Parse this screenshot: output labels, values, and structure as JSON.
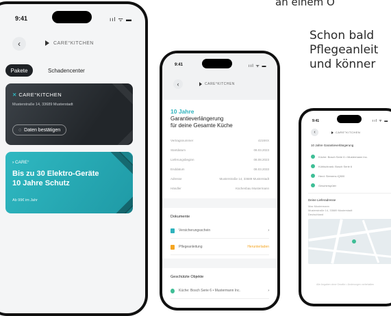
{
  "background_text": {
    "line0": "an einem O",
    "line1": "Schon bald",
    "line2": "Pflegeanleit",
    "line3": "und könner"
  },
  "status": {
    "time": "9:41",
    "icons": "ııl ᯤ ▬"
  },
  "brand": "CARE°KITCHEN",
  "back_icon": "‹",
  "phone1": {
    "tabs": [
      "Pakete",
      "Schadencenter"
    ],
    "card1": {
      "logo": "CARE°KITCHEN",
      "address": "Musterstraße 14, 33689 Musterstadt",
      "button": "Daten bestätigen"
    },
    "card2": {
      "logo": "CARE°",
      "headline1": "Bis zu 30 Elektro-Geräte",
      "headline2": "10 Jahre Schutz",
      "price": "Ab 99€ im Jahr"
    }
  },
  "phone2": {
    "title1": "10 Jahre",
    "title2": "Garantieverlängerung",
    "title3": "für deine Gesamte Küche",
    "rows": [
      [
        "Vertragsnummer",
        "4219XX"
      ],
      [
        "Startdatum",
        "08.03.2023"
      ],
      [
        "Lieferungsbeginn",
        "08.08.2023"
      ],
      [
        "Enddatum",
        "08.03.2033"
      ],
      [
        "Adresse",
        "Musterstraße 14, 33689 Musterstadt"
      ],
      [
        "Händler",
        "Küchenbau Mustermann"
      ]
    ],
    "docs_title": "Dokumente",
    "docs": [
      {
        "label": "Versicherungsschein",
        "action": "›"
      },
      {
        "label": "Pflegeanleitung",
        "action": "Herunterladen"
      }
    ],
    "devices_title": "Geschützte Objekte",
    "device": "Küche: Bosch Serie 6 • Mustermann Inc.",
    "colors": {
      "teal": "#2fb3bd",
      "orange": "#f5a623"
    }
  },
  "phone3": {
    "header": "10 Jahre Garantieverlängerung",
    "checks": [
      "Küche: Bosch Serie 6 • Mustermann Inc.",
      "Kühlschrank: Bosch Serie 6",
      "Herd: Siemens iQ500",
      "Geschirrspüler"
    ],
    "address_title": "Deine Lieferadresse",
    "address_lines": [
      "Max Mustermann",
      "Musterstraße 14, 33689 Musterstadt",
      "Deutschland"
    ],
    "footer": "Alle Angaben ohne Gewähr • Änderungen vorbehalten"
  }
}
